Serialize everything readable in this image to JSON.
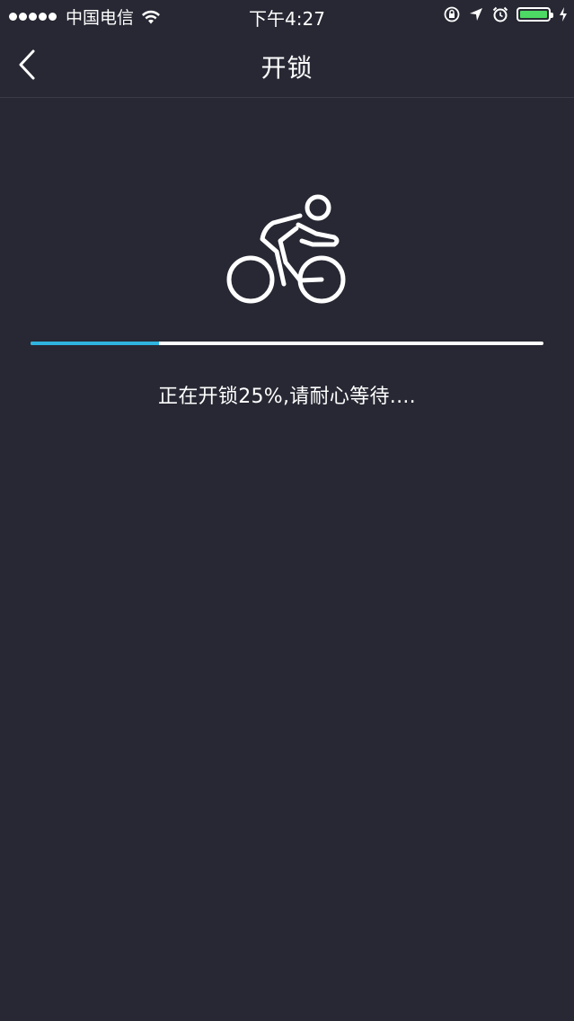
{
  "status_bar": {
    "carrier": "中国电信",
    "time": "下午4:27",
    "battery_color": "#4cd964"
  },
  "nav": {
    "title": "开锁",
    "back_icon": "chevron-left-icon"
  },
  "unlock": {
    "icon": "bicycle-rider-icon",
    "progress": 0.25,
    "message": "正在开锁25%,请耐心等待....",
    "progress_color": "#2fb4e0",
    "track_color": "#ffffff"
  },
  "theme": {
    "background": "#272833"
  }
}
